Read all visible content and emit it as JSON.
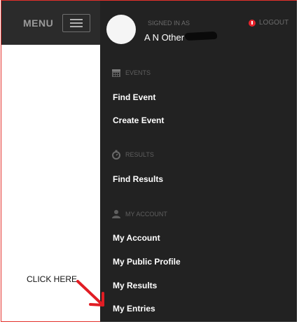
{
  "topbar": {
    "menu_label": "MENU"
  },
  "user": {
    "signed_in_label": "SIGNED IN AS",
    "name": "A N Other"
  },
  "logout": {
    "label": "LOGOUT"
  },
  "sections": {
    "events": {
      "heading": "EVENTS",
      "items": [
        "Find Event",
        "Create Event"
      ]
    },
    "results": {
      "heading": "RESULTS",
      "items": [
        "Find Results"
      ]
    },
    "account": {
      "heading": "MY ACCOUNT",
      "items": [
        "My Account",
        "My Public Profile",
        "My Results",
        "My Entries"
      ]
    }
  },
  "annotation": {
    "text": "CLICK HERE"
  },
  "colors": {
    "accent": "#e8232b",
    "panel": "#222222",
    "topbar": "#2b2b2b",
    "frame": "#e3302b",
    "arrow": "#e11d24"
  }
}
